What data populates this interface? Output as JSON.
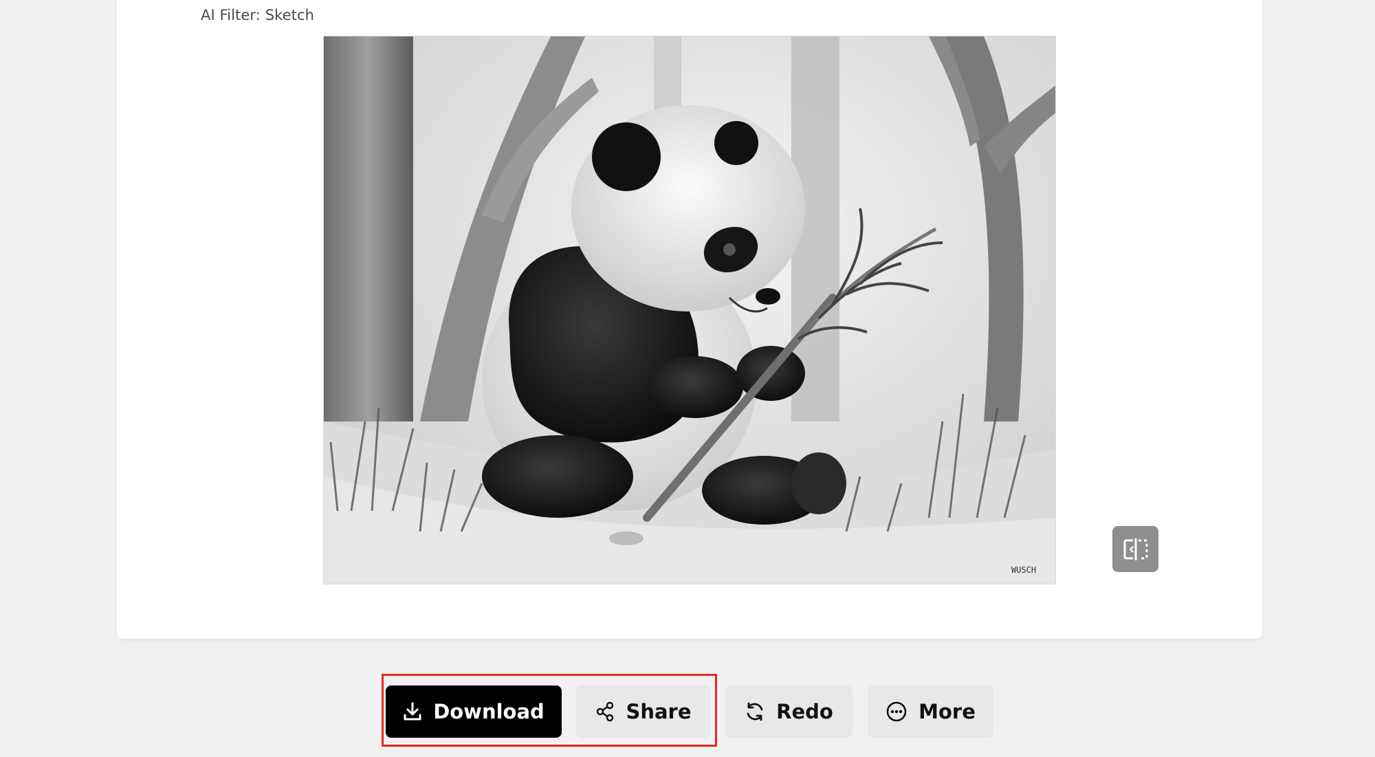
{
  "filter": {
    "label": "AI Filter: Sketch"
  },
  "image": {
    "subject": "pencil sketch of a panda eating bamboo in a forest",
    "signature": "WUSCH"
  },
  "compare": {
    "icon": "compare-split-icon"
  },
  "actions": {
    "download_label": "Download",
    "share_label": "Share",
    "redo_label": "Redo",
    "more_label": "More"
  },
  "icons": {
    "download": "download-icon",
    "share": "share-icon",
    "redo": "redo-icon",
    "more": "more-icon"
  },
  "colors": {
    "primary_button": "#000000",
    "secondary_button": "#e8e8e8",
    "highlight": "#e8291c",
    "compare_button": "#8f8f8f"
  }
}
